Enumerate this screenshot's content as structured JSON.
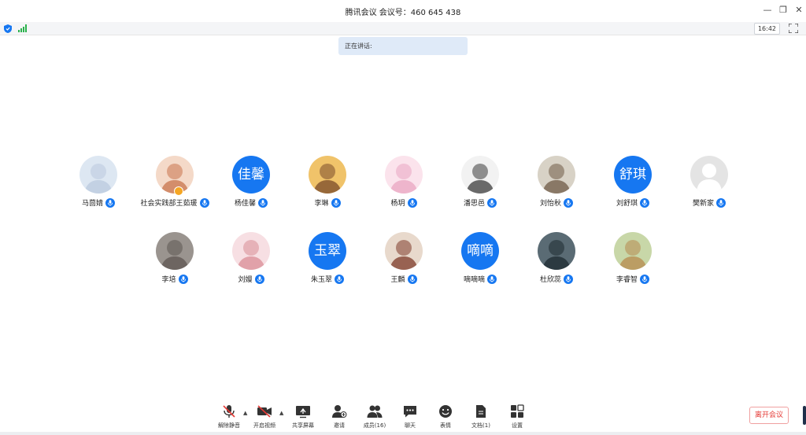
{
  "window": {
    "title": "腾讯会议 会议号：460 645 438",
    "minimize": "—",
    "restore": "❐",
    "close": "✕"
  },
  "status": {
    "clock": "16:42"
  },
  "speaking": {
    "label": "正在讲话:"
  },
  "participants": [
    {
      "name": "马茴婧",
      "avatar": "photo"
    },
    {
      "name": "社会实践部王茹瑗",
      "avatar": "photo",
      "host": true
    },
    {
      "name": "杨佳馨",
      "avatar_text": "佳馨"
    },
    {
      "name": "李琳",
      "avatar": "photo"
    },
    {
      "name": "杨玥",
      "avatar": "photo"
    },
    {
      "name": "潘思邑",
      "avatar": "photo"
    },
    {
      "name": "刘怡秋",
      "avatar": "photo"
    },
    {
      "name": "刘舒琪",
      "avatar_text": "舒琪"
    },
    {
      "name": "樊新家",
      "avatar": "default"
    },
    {
      "name": "李培",
      "avatar": "photo"
    },
    {
      "name": "刘嫚",
      "avatar": "photo"
    },
    {
      "name": "朱玉翠",
      "avatar_text": "玉翠"
    },
    {
      "name": "王麟",
      "avatar": "photo"
    },
    {
      "name": "嘀嘀嘀",
      "avatar_text": "嘀嘀"
    },
    {
      "name": "杜欣蕊",
      "avatar": "photo"
    },
    {
      "name": "李睿智",
      "avatar": "photo"
    }
  ],
  "toolbar": {
    "unmute": "解除静音",
    "video": "开启视频",
    "share": "共享屏幕",
    "invite": "邀请",
    "members": "成员(16)",
    "chat": "聊天",
    "emoji": "表情",
    "docs": "文档(1)",
    "settings": "设置",
    "caret": "▲",
    "leave": "离开会议"
  },
  "colors": {
    "accent": "#1677f1",
    "leave": "#e53935",
    "banner": "#dfeaf8"
  }
}
